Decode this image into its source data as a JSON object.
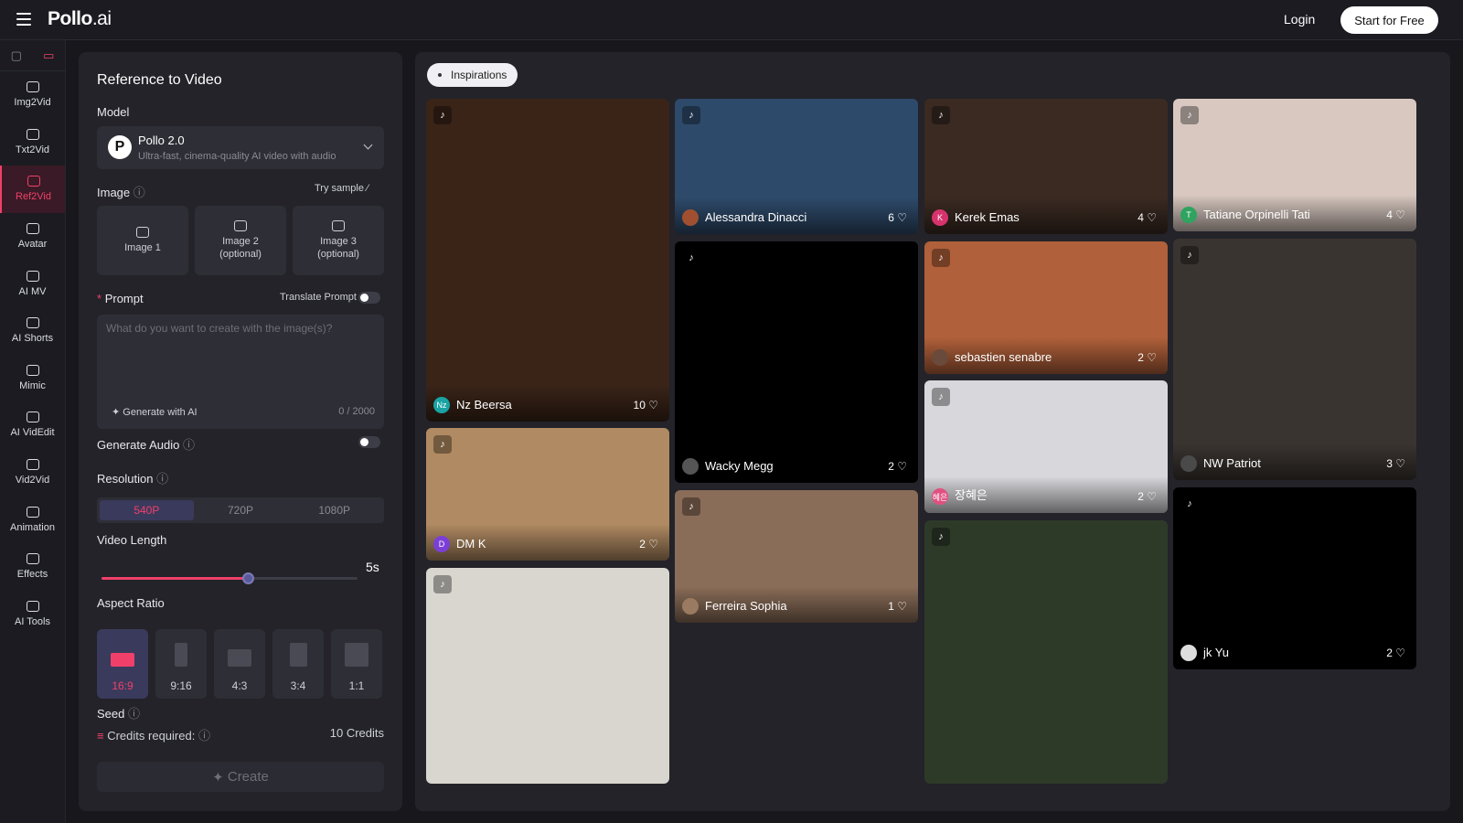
{
  "header": {
    "logo_main": "Pollo",
    "logo_suffix": ".ai",
    "login": "Login",
    "start": "Start for Free"
  },
  "rail": [
    {
      "label": "Img2Vid"
    },
    {
      "label": "Txt2Vid"
    },
    {
      "label": "Ref2Vid",
      "active": true
    },
    {
      "label": "Avatar"
    },
    {
      "label": "AI MV"
    },
    {
      "label": "AI Shorts"
    },
    {
      "label": "Mimic"
    },
    {
      "label": "AI VidEdit"
    },
    {
      "label": "Vid2Vid"
    },
    {
      "label": "Animation"
    },
    {
      "label": "Effects"
    },
    {
      "label": "AI Tools"
    }
  ],
  "panel": {
    "title": "Reference to Video",
    "model_label": "Model",
    "model_name": "Pollo 2.0",
    "model_desc": "Ultra-fast, cinema-quality AI video with audio",
    "image_label": "Image",
    "try_sample": "Try sample",
    "slots": [
      {
        "line1": "Image 1",
        "line2": ""
      },
      {
        "line1": "Image 2",
        "line2": "(optional)"
      },
      {
        "line1": "Image 3",
        "line2": "(optional)"
      }
    ],
    "prompt_label": "Prompt",
    "translate": "Translate Prompt",
    "placeholder": "What do you want to create with the image(s)?",
    "generate_ai": "Generate with AI",
    "char_count": "0 / 2000",
    "audio_label": "Generate Audio",
    "resolution_label": "Resolution",
    "resolutions": [
      "540P",
      "720P",
      "1080P"
    ],
    "video_length_label": "Video Length",
    "video_length_value": "5s",
    "video_length_fraction": 0.57,
    "aspect_label": "Aspect Ratio",
    "aspects": [
      "16:9",
      "9:16",
      "4:3",
      "3:4",
      "1:1"
    ],
    "seed_label": "Seed",
    "credits_label": "Credits required:",
    "credits_value": "10 Credits",
    "create": "Create"
  },
  "gallery": {
    "pill": "Inspirations",
    "cards": [
      {
        "user": "Nz Beersa",
        "avatar": "Nz",
        "likes": "10",
        "color": "#3a2418"
      },
      {
        "user": "DM K",
        "avatar": "D",
        "likes": "2",
        "color": "#b08a62"
      },
      {
        "user": "",
        "avatar": "",
        "likes": "",
        "color": "#d9d6cf"
      },
      {
        "user": "Alessandra Dinacci",
        "avatar": "",
        "likes": "6",
        "color": "#2e4a6a"
      },
      {
        "user": "Wacky Megg",
        "avatar": "",
        "likes": "2",
        "color": "#000000"
      },
      {
        "user": "Ferreira Sophia",
        "avatar": "",
        "likes": "1",
        "color": "#8a6d58"
      },
      {
        "user": "Kerek Emas",
        "avatar": "K",
        "likes": "4",
        "color": "#3a2a22"
      },
      {
        "user": "sebastien senabre",
        "avatar": "",
        "likes": "2",
        "color": "#b0603a"
      },
      {
        "user": "장혜은",
        "avatar": "혜은",
        "likes": "2",
        "color": "#d8d8dc"
      },
      {
        "user": "",
        "avatar": "",
        "likes": "",
        "color": "#2e3a28"
      },
      {
        "user": "Tatiane Orpinelli Tati",
        "avatar": "T",
        "likes": "4",
        "color": "#d8c8c0"
      },
      {
        "user": "NW Patriot",
        "avatar": "",
        "likes": "3",
        "color": "#3a3430"
      },
      {
        "user": "jk Yu",
        "avatar": "",
        "likes": "2",
        "color": "#000000"
      }
    ]
  }
}
